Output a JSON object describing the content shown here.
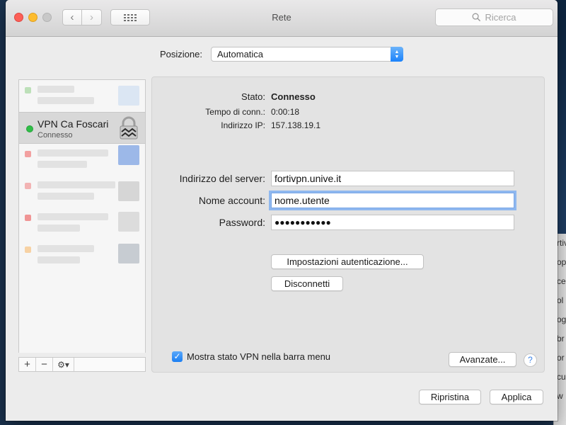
{
  "window": {
    "title": "Rete"
  },
  "search": {
    "placeholder": "Ricerca"
  },
  "location": {
    "label": "Posizione:",
    "value": "Automatica"
  },
  "sidebar": {
    "selected": {
      "name": "VPN Ca Foscari",
      "status": "Connesso",
      "status_color": "#2fbf47"
    }
  },
  "status": {
    "state_label": "Stato:",
    "state_value": "Connesso",
    "time_label": "Tempo di conn.:",
    "time_value": "0:00:18",
    "ip_label": "Indirizzo IP:",
    "ip_value": "157.138.19.1"
  },
  "form": {
    "server_label": "Indirizzo del server:",
    "server_value": "fortivpn.unive.it",
    "account_label": "Nome account:",
    "account_value": "nome.utente",
    "password_label": "Password:",
    "password_value": "●●●●●●●●●●●"
  },
  "buttons": {
    "auth_settings": "Impostazioni autenticazione...",
    "disconnect": "Disconnetti",
    "advanced": "Avanzate...",
    "help": "?",
    "revert": "Ripristina",
    "apply": "Applica"
  },
  "options": {
    "show_vpn_status": "Mostra stato VPN nella barra menu",
    "show_vpn_status_checked": true
  },
  "sidebar_tools": {
    "add": "+",
    "remove": "−",
    "gear": "⚙▾"
  },
  "behind_window": [
    "rtiv",
    "op",
    "ce",
    "ol",
    "og",
    "br",
    "or",
    "cu",
    "w"
  ]
}
